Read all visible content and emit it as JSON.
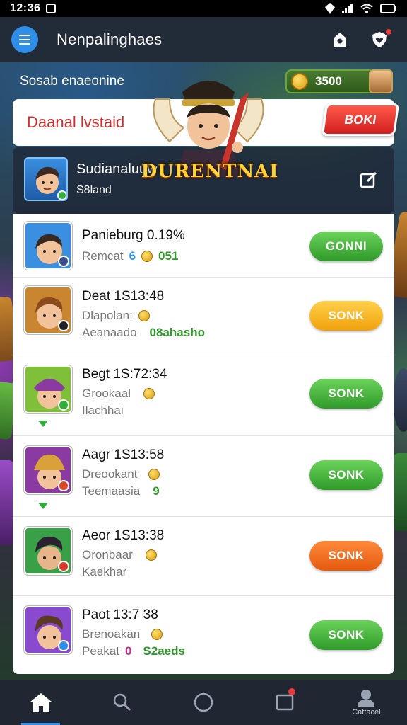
{
  "status_bar": {
    "time": "12:36"
  },
  "app_bar": {
    "title": "Nenpalinghaes"
  },
  "wallet": {
    "section_label": "Sosab enaeonine",
    "coins": "3500"
  },
  "banner": {
    "text": "Daanal lvstaid",
    "button_label": "BOKI"
  },
  "mascot": {
    "logo_text": "DURENTNAI"
  },
  "profile": {
    "name": "Sudianaluuw",
    "subtitle": "S8land"
  },
  "rows": [
    {
      "title": "Panieburg 0.19%",
      "line1_label": "Remcat",
      "line1_num": "6",
      "line1_value": "051",
      "line1_color": "#2f9a2a",
      "line2_label": "",
      "line2_value": "",
      "button_label": "GONNI",
      "button_style": "green",
      "avatar_color": "#3a8fe0",
      "badge_color": "#3b4d8a"
    },
    {
      "title": "Deat 1S13:48",
      "line1_label": "Dlapolan:",
      "line1_num": "",
      "line1_value": "",
      "line1_color": "#2f9a2a",
      "line2_label": "Aeanaado",
      "line2_value": "08ahasho",
      "button_label": "SONK",
      "button_style": "yellow",
      "avatar_color": "#c9852f",
      "badge_color": "#222222"
    },
    {
      "title": "Begt 1S:72:34",
      "line1_label": "Grookaal",
      "line1_num": "",
      "line1_value": "",
      "line1_color": "#2f9a2a",
      "line2_label": "Ilachhai",
      "line2_value": "",
      "button_label": "SONK",
      "button_style": "green",
      "avatar_color": "#7fbf3a",
      "badge_color": "#2fae3a"
    },
    {
      "title": "Aagr 1S13:58",
      "line1_label": "Dreookant",
      "line1_num": "",
      "line1_value": "",
      "line1_color": "#2f9a2a",
      "line2_label": "Teemaasia",
      "line2_value": "9",
      "button_label": "SONK",
      "button_style": "green",
      "avatar_color": "#8a3aa0",
      "badge_color": "#d84a2a"
    },
    {
      "title": "Aeor 1S13:38",
      "line1_label": "Oronbaar",
      "line1_num": "",
      "line1_value": "",
      "line1_color": "#2f9a2a",
      "line2_label": "Kaekhar",
      "line2_value": "",
      "button_label": "SONK",
      "button_style": "orange",
      "avatar_color": "#3aa048",
      "badge_color": "#d83a2a"
    },
    {
      "title": "Paot 13:7 38",
      "line1_label": "Brenoakan",
      "line1_num": "",
      "line1_value": "",
      "line1_color": "#2f9a2a",
      "line2_label": "Peakat",
      "line2_num": "0",
      "line2_value": "S2aeds",
      "button_label": "SONK",
      "button_style": "green",
      "avatar_color": "#8a4ad0",
      "badge_color": "#2f8fe8"
    }
  ],
  "bottom_nav": {
    "items": [
      {
        "icon": "home-icon",
        "label": ""
      },
      {
        "icon": "search-icon",
        "label": ""
      },
      {
        "icon": "circle-icon",
        "label": ""
      },
      {
        "icon": "inbox-icon",
        "label": ""
      },
      {
        "icon": "profile-icon",
        "label": "Cattacel"
      }
    ]
  },
  "colors": {
    "accent_blue": "#2f8fe8",
    "banner_red": "#d42f2f",
    "button_green": "#2f9a2a",
    "button_yellow": "#f0a10d",
    "button_orange": "#e55a0f"
  }
}
